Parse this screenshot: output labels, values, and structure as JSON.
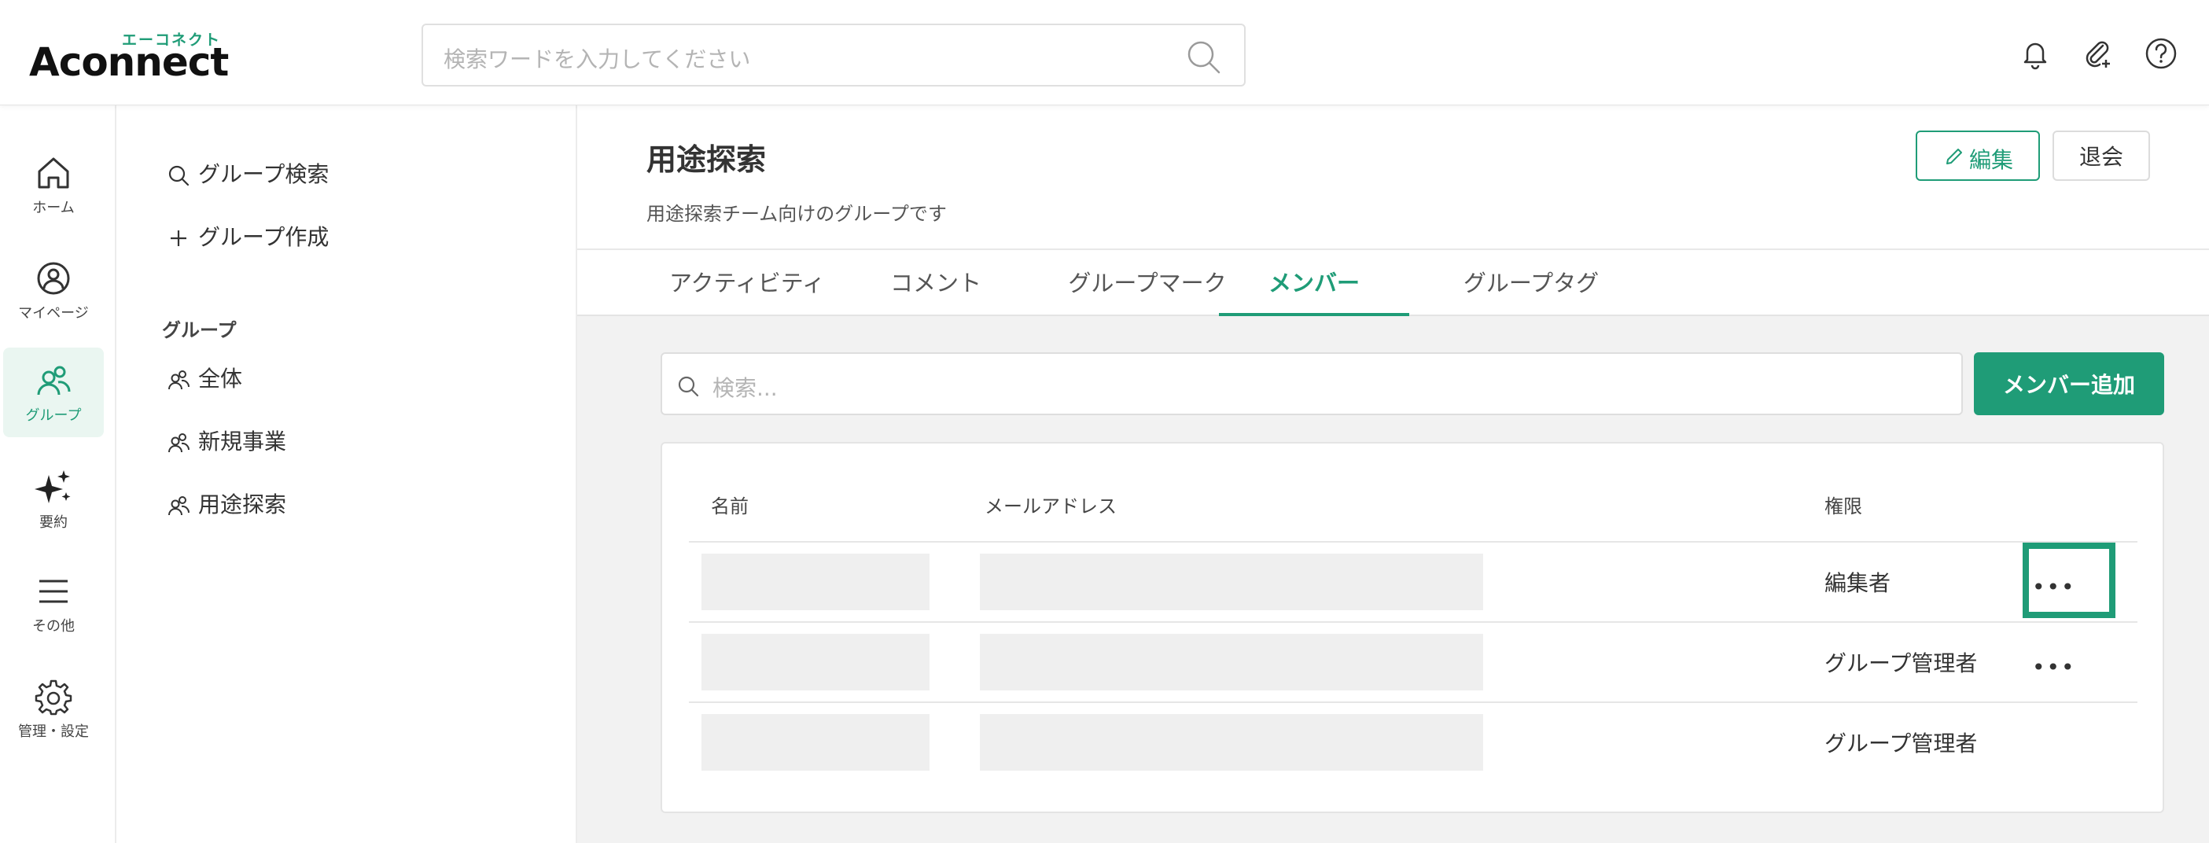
{
  "header": {
    "logo_kana": "エーコネクト",
    "logo_text": "Aconnect",
    "search_placeholder": "検索ワードを入力してください",
    "icons": [
      "bell-icon",
      "paperclip-icon",
      "help-icon"
    ]
  },
  "nav": {
    "items": [
      {
        "label": "ホーム",
        "icon": "home-icon"
      },
      {
        "label": "マイページ",
        "icon": "user-icon"
      },
      {
        "label": "グループ",
        "icon": "group-icon",
        "active": true
      },
      {
        "label": "要約",
        "icon": "sparkle-icon"
      },
      {
        "label": "その他",
        "icon": "menu-icon"
      },
      {
        "label": "管理・設定",
        "icon": "gear-icon"
      }
    ]
  },
  "group_sidebar": {
    "search_label": "グループ検索",
    "create_label": "グループ作成",
    "section_heading": "グループ",
    "groups": [
      "全体",
      "新規事業",
      "用途探索"
    ]
  },
  "page": {
    "title": "用途探索",
    "description": "用途探索チーム向けのグループです",
    "edit_label": "編集",
    "leave_label": "退会"
  },
  "tabs": [
    "アクティビティ",
    "コメント",
    "グループマーク",
    "メンバー",
    "グループタグ"
  ],
  "active_tab": "メンバー",
  "members": {
    "search_placeholder": "検索...",
    "add_label": "メンバー追加",
    "columns": {
      "name": "名前",
      "email": "メールアドレス",
      "role": "権限"
    },
    "rows": [
      {
        "role": "編集者",
        "has_menu": true
      },
      {
        "role": "グループ管理者",
        "has_menu": true
      },
      {
        "role": "グループ管理者",
        "has_menu": false
      }
    ],
    "menu_glyph": "•••"
  },
  "colors": {
    "accent": "#1f9c77",
    "placeholder_block": "#efefef"
  }
}
